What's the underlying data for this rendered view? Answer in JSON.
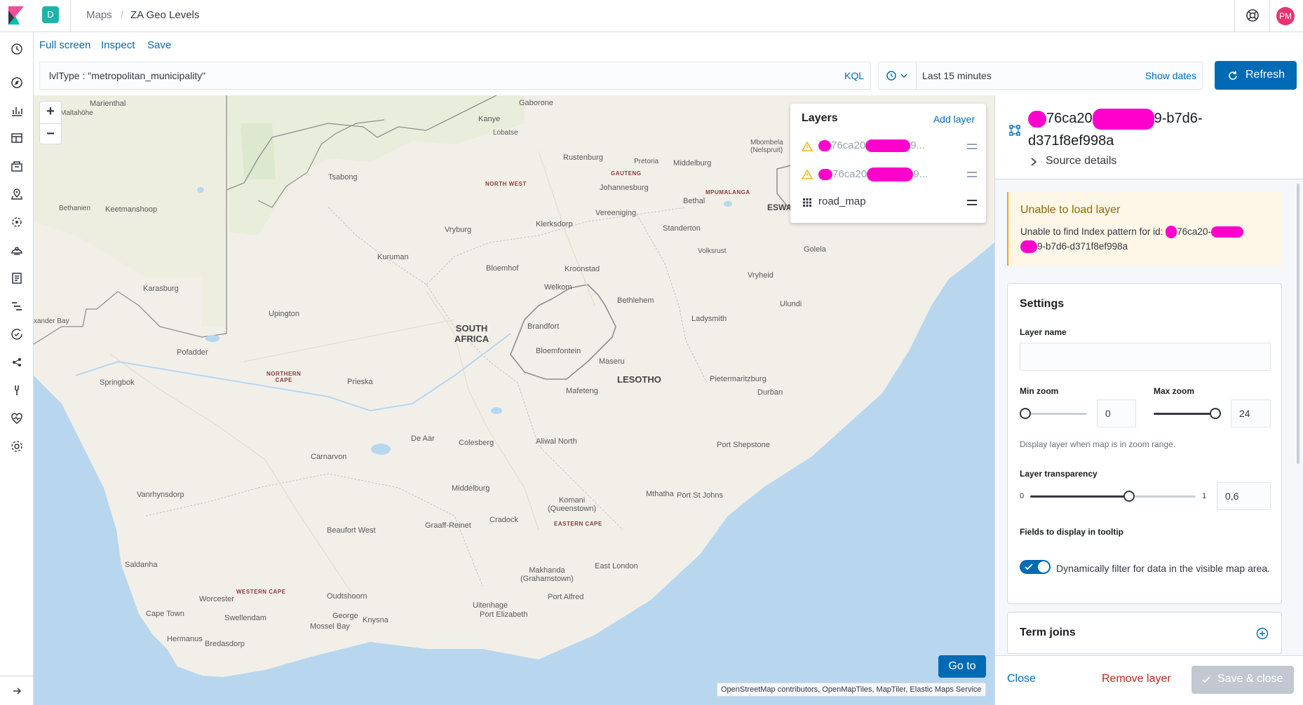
{
  "header": {
    "space_badge": "D",
    "breadcrumbs": [
      "Maps",
      "ZA Geo Levels"
    ],
    "breadcrumb_separator": "/",
    "avatar_initials": "PM",
    "avatar_color": "#e7336f"
  },
  "nav_icons": [
    "clock-icon",
    "compass-icon",
    "visualize-icon",
    "dashboard-icon",
    "canvas-icon",
    "maps-icon",
    "ml-icon",
    "infrastructure-icon",
    "logs-icon",
    "apm-icon",
    "uptime-icon",
    "graph-icon",
    "dev-tools-icon",
    "monitoring-icon",
    "management-icon"
  ],
  "top_menu": {
    "full_screen": "Full screen",
    "inspect": "Inspect",
    "save": "Save"
  },
  "query": {
    "text": "lvlType : \"metropolitan_municipality\"",
    "language": "KQL"
  },
  "date": {
    "range": "Last 15 minutes",
    "show_dates": "Show dates"
  },
  "refresh_label": "Refresh",
  "accent_color": "#006bb4",
  "map": {
    "labels": {
      "marienthal": "Marienthal",
      "aitahohe": "Maltahöhe",
      "bethanien": "Bethanien",
      "keetmanshoop": "Keetmanshoop",
      "karasburg": "Karasburg",
      "alexander_bay": "xander Bay",
      "pofadder": "Pofadder",
      "springbok": "Springbok",
      "upington": "Upington",
      "northern_cape": "NORTHERN\nCAPE",
      "prieska": "Prieska",
      "kuruman": "Kuruman",
      "tsabong": "Tsabong",
      "kanye": "Kanye",
      "lobatse": "Lobatse",
      "gaborone": "Gaborone",
      "north_west": "NORTH WEST",
      "rustenburg": "Rustenburg",
      "pretoria": "Pretoria",
      "gauteng": "GAUTENG",
      "johannesburg": "Johannesburg",
      "vereeniging": "Vereeniging",
      "mpumalanga": "MPUMALANGA",
      "mbombela": "Mbombela\n(Nelspruit)",
      "middelburg_n": "Middelburg",
      "bethal": "Bethal",
      "eswa": "ESWA",
      "vryburg": "Vryburg",
      "klerksdorp": "Klerksdorp",
      "standerton": "Standerton",
      "volksrust": "Volksrust",
      "bloemhof": "Bloemhof",
      "kroonstad": "Kroonstad",
      "welkom": "Welkom",
      "vryheid": "Vryheid",
      "golela": "Golela",
      "ulundi": "Ulundi",
      "bethlehem": "Bethlehem",
      "ladysmith": "Ladysmith",
      "south_africa": "SOUTH\nAFRICA",
      "brandfort": "Brandfort",
      "bloemfontein": "Bloemfontein",
      "maseru": "Maseru",
      "lesotho": "LESOTHO",
      "mafeteng": "Mafeteng",
      "pietermaritzburg": "Pietermaritzburg",
      "durban": "Durban",
      "de_aar": "De Aar",
      "colesberg": "Colesberg",
      "aliwal_north": "Aliwal North",
      "port_shepstone": "Port Shepstone",
      "carnarvon": "Carnarvon",
      "vanrhynsdorp": "Vanrhynsdorp",
      "middelburg_s": "Middelburg",
      "mthatha": "Mthatha",
      "port_st_johns": "Port St Johns",
      "komani": "Komani\n(Queenstown)",
      "cradock": "Cradock",
      "eastern_cape": "EASTERN CAPE",
      "beaufort_west": "Beaufort West",
      "graaff_reinet": "Graaff-Reinet",
      "saldanha": "Saldanha",
      "east_london": "East London",
      "makhanda": "Makhanda\n(Grahamstown)",
      "port_alfred": "Port Alfred",
      "worcester": "Worcester",
      "western_cape": "WESTERN CAPE",
      "oudtshoorn": "Oudtshoorn",
      "uitenhage": "Uitenhage",
      "port_elizabeth": "Port Elizabeth",
      "cape_town": "Cape Town",
      "swellendam": "Swellendam",
      "george": "George",
      "knysna": "Knysna",
      "mossel_bay": "Mossel Bay",
      "hermanus": "Hermanus",
      "bredasdorp": "Bredasdorp"
    },
    "go_to": "Go to",
    "attribution": "OpenStreetMap contributors, OpenMapTiles, MapTiler, Elastic Maps Service"
  },
  "layers_panel": {
    "title": "Layers",
    "add_layer": "Add layer",
    "layers": [
      {
        "name_prefix": "76ca20",
        "name_suffix": "9...",
        "status": "warning"
      },
      {
        "name_prefix": "76ca20",
        "name_suffix": "9...",
        "status": "warning"
      },
      {
        "name": "road_map",
        "status": "ok"
      }
    ]
  },
  "layer_details": {
    "title_part1": "76ca20",
    "title_part2": "9-b7d6-",
    "title_part3": "d371f8ef998a",
    "source_details": "Source details",
    "error_title": "Unable to load layer",
    "error_body_1": "Unable to find Index pattern for id:",
    "error_body_2": "76ca20-",
    "error_body_3": "9-b7d6-d371f8ef998a",
    "settings_title": "Settings",
    "layer_name_label": "Layer name",
    "layer_name_value": "",
    "min_zoom_label": "Min zoom",
    "min_zoom_value": "0",
    "max_zoom_label": "Max zoom",
    "max_zoom_value": "24",
    "zoom_help": "Display layer when map is in zoom range.",
    "transparency_label": "Layer transparency",
    "transparency_min": "0",
    "transparency_max": "1",
    "transparency_value": "0,6",
    "tooltip_label": "Fields to display in tooltip",
    "filter_toggle_label": "Dynamically filter for data in the visible map area.",
    "filter_toggle_on": true,
    "term_joins": "Term joins",
    "close": "Close",
    "remove_layer": "Remove layer",
    "save_close": "Save & close"
  }
}
